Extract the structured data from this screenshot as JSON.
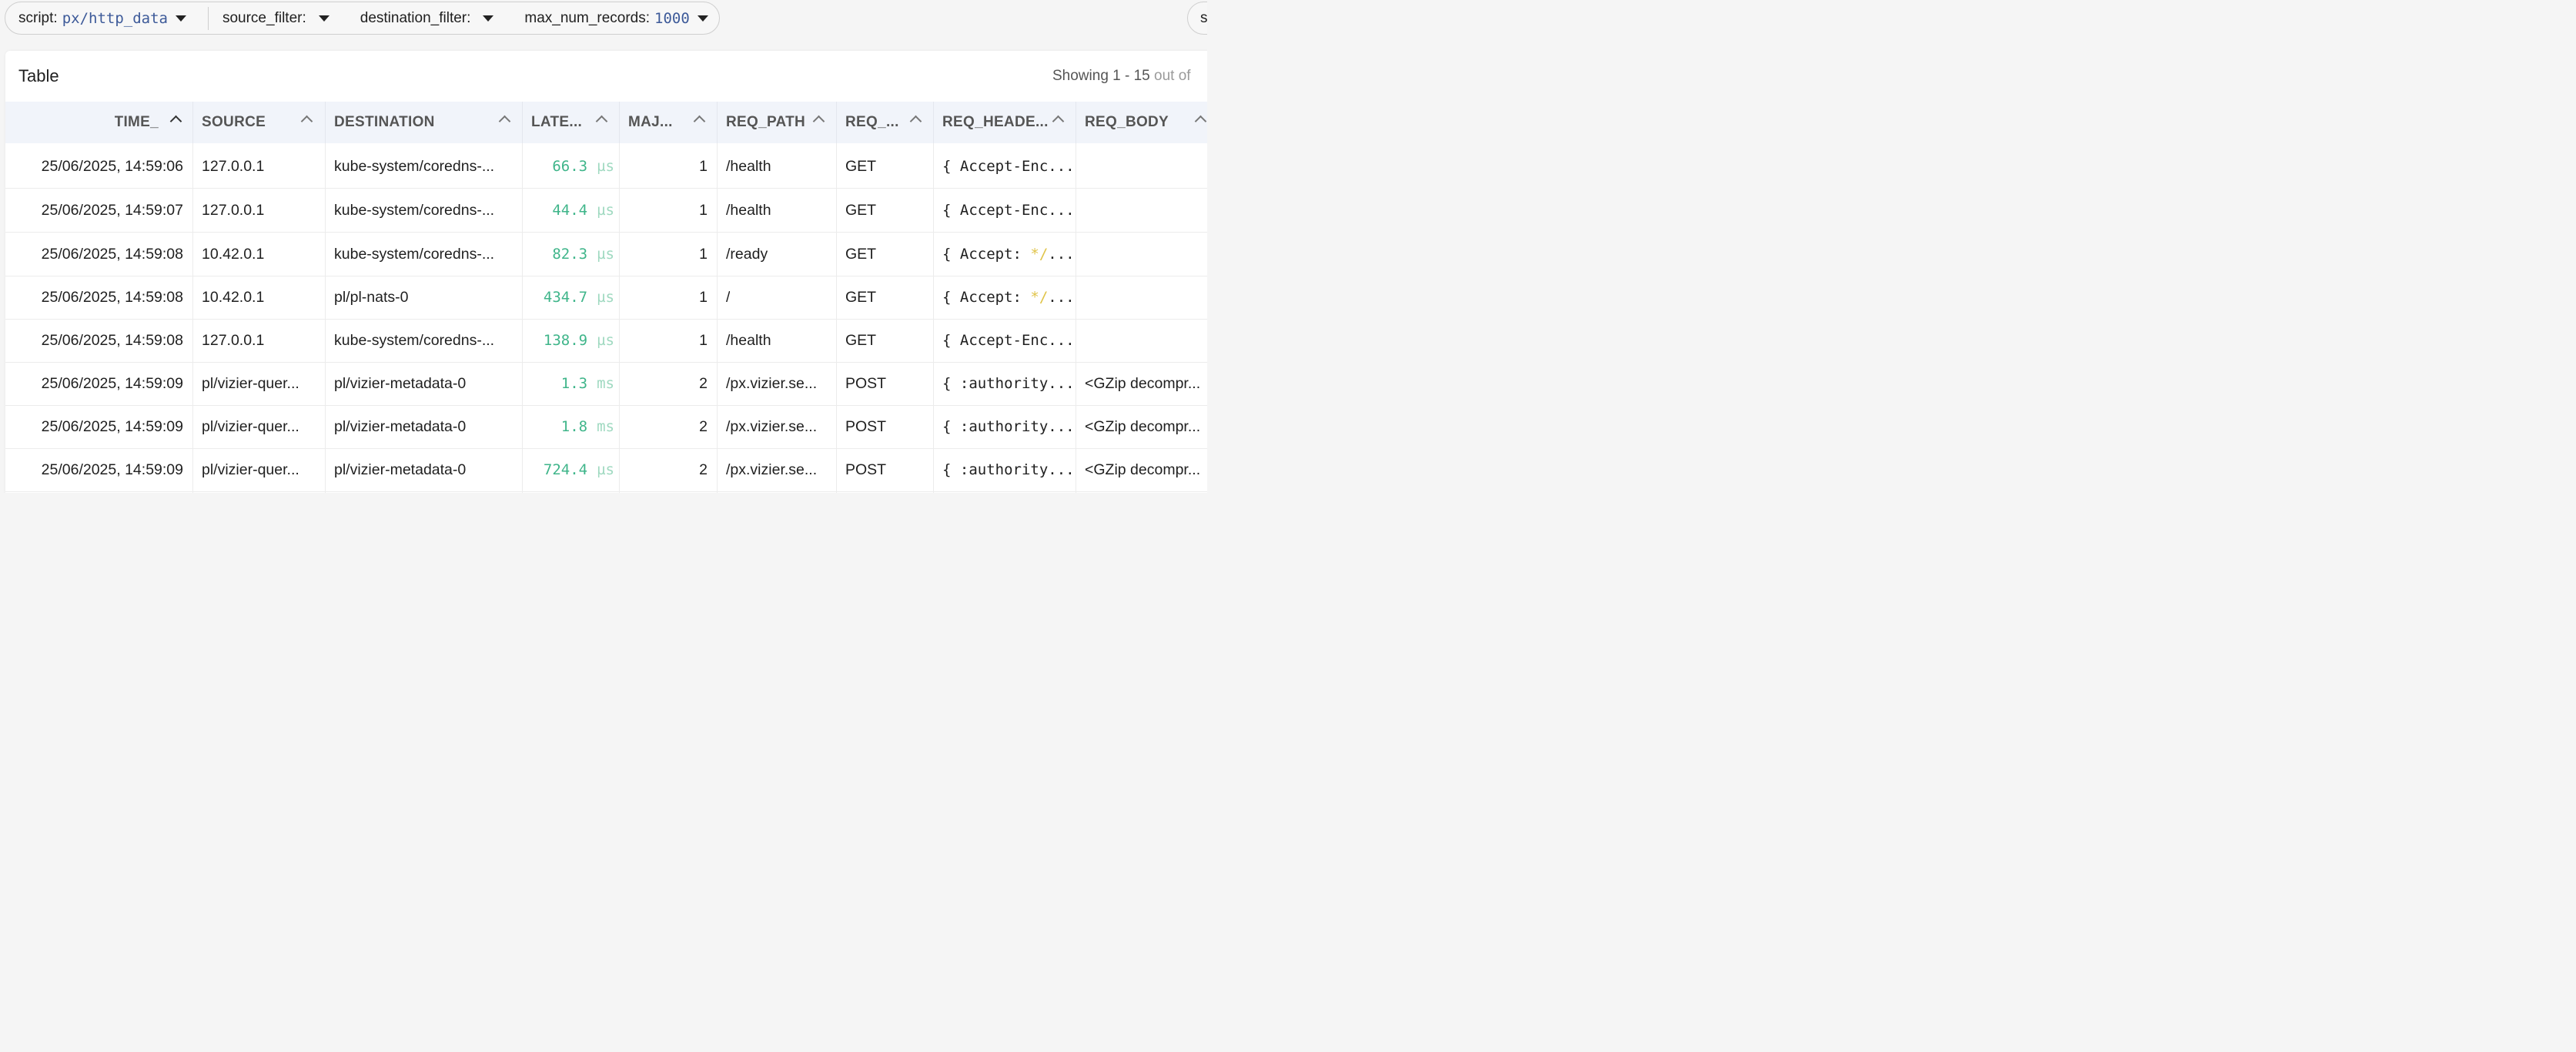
{
  "toolbar": {
    "script": {
      "label": "script:",
      "value": "px/http_data"
    },
    "source_filter": {
      "label": "source_filter:",
      "value": ""
    },
    "destination_filter": {
      "label": "destination_filter:",
      "value": ""
    },
    "max_num_records": {
      "label": "max_num_records:",
      "value": "1000"
    },
    "right_pill_label": "s"
  },
  "card": {
    "title": "Table",
    "showing": "Showing 1 - 15",
    "out_of": "out of"
  },
  "columns": [
    "TIME_",
    "SOURCE",
    "DESTINATION",
    "LATE...",
    "MAJ...",
    "REQ_PATH",
    "REQ_...",
    "REQ_HEADE...",
    "REQ_BODY"
  ],
  "rows": [
    {
      "time": "25/06/2025, 14:59:06",
      "source": "127.0.0.1",
      "destination": "kube-system/coredns-...",
      "latency": "66.3",
      "latency_unit": "µs",
      "major": "1",
      "req_path": "/health",
      "method": "GET",
      "headers": "{ Accept-Enc...",
      "headers_accent": "",
      "headers_tail": "",
      "body": ""
    },
    {
      "time": "25/06/2025, 14:59:07",
      "source": "127.0.0.1",
      "destination": "kube-system/coredns-...",
      "latency": "44.4",
      "latency_unit": "µs",
      "major": "1",
      "req_path": "/health",
      "method": "GET",
      "headers": "{ Accept-Enc...",
      "headers_accent": "",
      "headers_tail": "",
      "body": ""
    },
    {
      "time": "25/06/2025, 14:59:08",
      "source": "10.42.0.1",
      "destination": "kube-system/coredns-...",
      "latency": "82.3",
      "latency_unit": "µs",
      "major": "1",
      "req_path": "/ready",
      "method": "GET",
      "headers": "{ Accept: ",
      "headers_accent": "*/",
      "headers_tail": "...",
      "body": ""
    },
    {
      "time": "25/06/2025, 14:59:08",
      "source": "10.42.0.1",
      "destination": "pl/pl-nats-0",
      "latency": "434.7",
      "latency_unit": "µs",
      "major": "1",
      "req_path": "/",
      "method": "GET",
      "headers": "{ Accept: ",
      "headers_accent": "*/",
      "headers_tail": "...",
      "body": ""
    },
    {
      "time": "25/06/2025, 14:59:08",
      "source": "127.0.0.1",
      "destination": "kube-system/coredns-...",
      "latency": "138.9",
      "latency_unit": "µs",
      "major": "1",
      "req_path": "/health",
      "method": "GET",
      "headers": "{ Accept-Enc...",
      "headers_accent": "",
      "headers_tail": "",
      "body": ""
    },
    {
      "time": "25/06/2025, 14:59:09",
      "source": "pl/vizier-quer...",
      "destination": "pl/vizier-metadata-0",
      "latency": "1.3",
      "latency_unit": "ms",
      "major": "2",
      "req_path": "/px.vizier.se...",
      "method": "POST",
      "headers": "{ :authority...",
      "headers_accent": "",
      "headers_tail": "",
      "body": "<GZip decompr..."
    },
    {
      "time": "25/06/2025, 14:59:09",
      "source": "pl/vizier-quer...",
      "destination": "pl/vizier-metadata-0",
      "latency": "1.8",
      "latency_unit": "ms",
      "major": "2",
      "req_path": "/px.vizier.se...",
      "method": "POST",
      "headers": "{ :authority...",
      "headers_accent": "",
      "headers_tail": "",
      "body": "<GZip decompr..."
    },
    {
      "time": "25/06/2025, 14:59:09",
      "source": "pl/vizier-quer...",
      "destination": "pl/vizier-metadata-0",
      "latency": "724.4",
      "latency_unit": "µs",
      "major": "2",
      "req_path": "/px.vizier.se...",
      "method": "POST",
      "headers": "{ :authority...",
      "headers_accent": "",
      "headers_tail": "",
      "body": "<GZip decompr..."
    }
  ]
}
